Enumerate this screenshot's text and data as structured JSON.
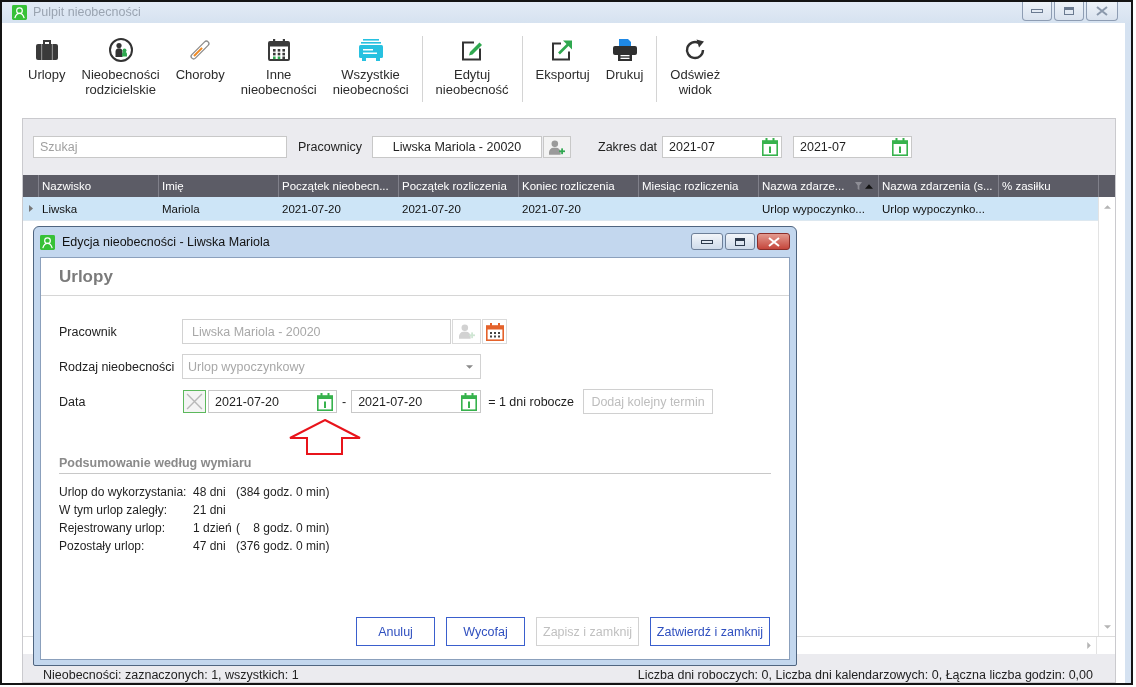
{
  "window": {
    "title": "Pulpit nieobecności"
  },
  "toolbar": {
    "groups": [
      [
        {
          "label": "Urlopy"
        },
        {
          "label": "Nieobecności\nrodzicielskie"
        },
        {
          "label": "Choroby"
        },
        {
          "label": "Inne\nnieobecności"
        },
        {
          "label": "Wszystkie\nnieobecności"
        }
      ],
      [
        {
          "label": "Edytuj\nnieobecność"
        }
      ],
      [
        {
          "label": "Eksportuj"
        },
        {
          "label": "Drukuj"
        }
      ],
      [
        {
          "label": "Odśwież\nwidok"
        }
      ]
    ]
  },
  "filters": {
    "search": {
      "placeholder": "Szukaj"
    },
    "employees": {
      "label": "Pracownicy",
      "value": "Liwska Mariola - 20020"
    },
    "date_range": {
      "label": "Zakres dat",
      "from": "2021-07",
      "to": "2021-07"
    }
  },
  "table": {
    "columns": [
      {
        "label": "Nazwisko",
        "sorted": false,
        "filtered": false
      },
      {
        "label": "Imię",
        "sorted": false,
        "filtered": false
      },
      {
        "label": "Początek nieobecn...",
        "sorted": false,
        "filtered": false
      },
      {
        "label": "Początek rozliczenia",
        "sorted": false,
        "filtered": false
      },
      {
        "label": "Koniec rozliczenia",
        "sorted": false,
        "filtered": false
      },
      {
        "label": "Miesiąc rozliczenia",
        "sorted": false,
        "filtered": false
      },
      {
        "label": "Nazwa zdarze...",
        "sorted": true,
        "filtered": true
      },
      {
        "label": "Nazwa zdarzenia (s...",
        "sorted": false,
        "filtered": false
      },
      {
        "label": "% zasiłku",
        "sorted": false,
        "filtered": false
      }
    ],
    "rows": [
      {
        "selected": true,
        "cells": [
          "Liwska",
          "Mariola",
          "2021-07-20",
          "2021-07-20",
          "2021-07-20",
          null,
          "Urlop wypoczynko...",
          "Urlop wypoczynko...",
          null
        ]
      }
    ]
  },
  "status_bar": {
    "selection": "Nieobecności: zaznaczonych: 1, wszystkich: 1",
    "totals": "Liczba dni roboczych: 0, Liczba dni kalendarzowych: 0, Łączna liczba godzin: 0,00"
  },
  "dialog": {
    "title": "Edycja nieobecności - Liwska Mariola",
    "heading": "Urlopy",
    "employee": {
      "label": "Pracownik",
      "value": "Liwska Mariola - 20020",
      "disabled": true
    },
    "absence_type": {
      "label": "Rodzaj nieobecności",
      "value": "Urlop wypoczynkowy",
      "disabled": true
    },
    "date": {
      "label": "Data",
      "from": "2021-07-20",
      "separator": "-",
      "to": "2021-07-20",
      "working_days": "= 1 dni robocze",
      "add_button": {
        "label": "Dodaj kolejny termin",
        "disabled": true
      }
    },
    "summary": {
      "title": "Podsumowanie według wymiaru",
      "rows": [
        {
          "label": "Urlop do wykorzystania:",
          "days": "48 dni",
          "hours": "(384 godz. 0 min)"
        },
        {
          "label": "W tym urlop zaległy:",
          "days": "21 dni"
        },
        {
          "label": "Rejestrowany urlop:",
          "days": "1 dzień",
          "hours": "(    8 godz. 0 min)"
        },
        {
          "label": "Pozostały urlop:",
          "days": "47 dni",
          "hours": "(376 godz. 0 min)"
        }
      ]
    },
    "buttons": [
      {
        "label": "Anuluj",
        "disabled": false
      },
      {
        "label": "Wycofaj",
        "disabled": false
      },
      {
        "label": "Zapisz i zamknij",
        "disabled": true
      },
      {
        "label": "Zatwierdź i zamknij",
        "disabled": false
      }
    ]
  }
}
